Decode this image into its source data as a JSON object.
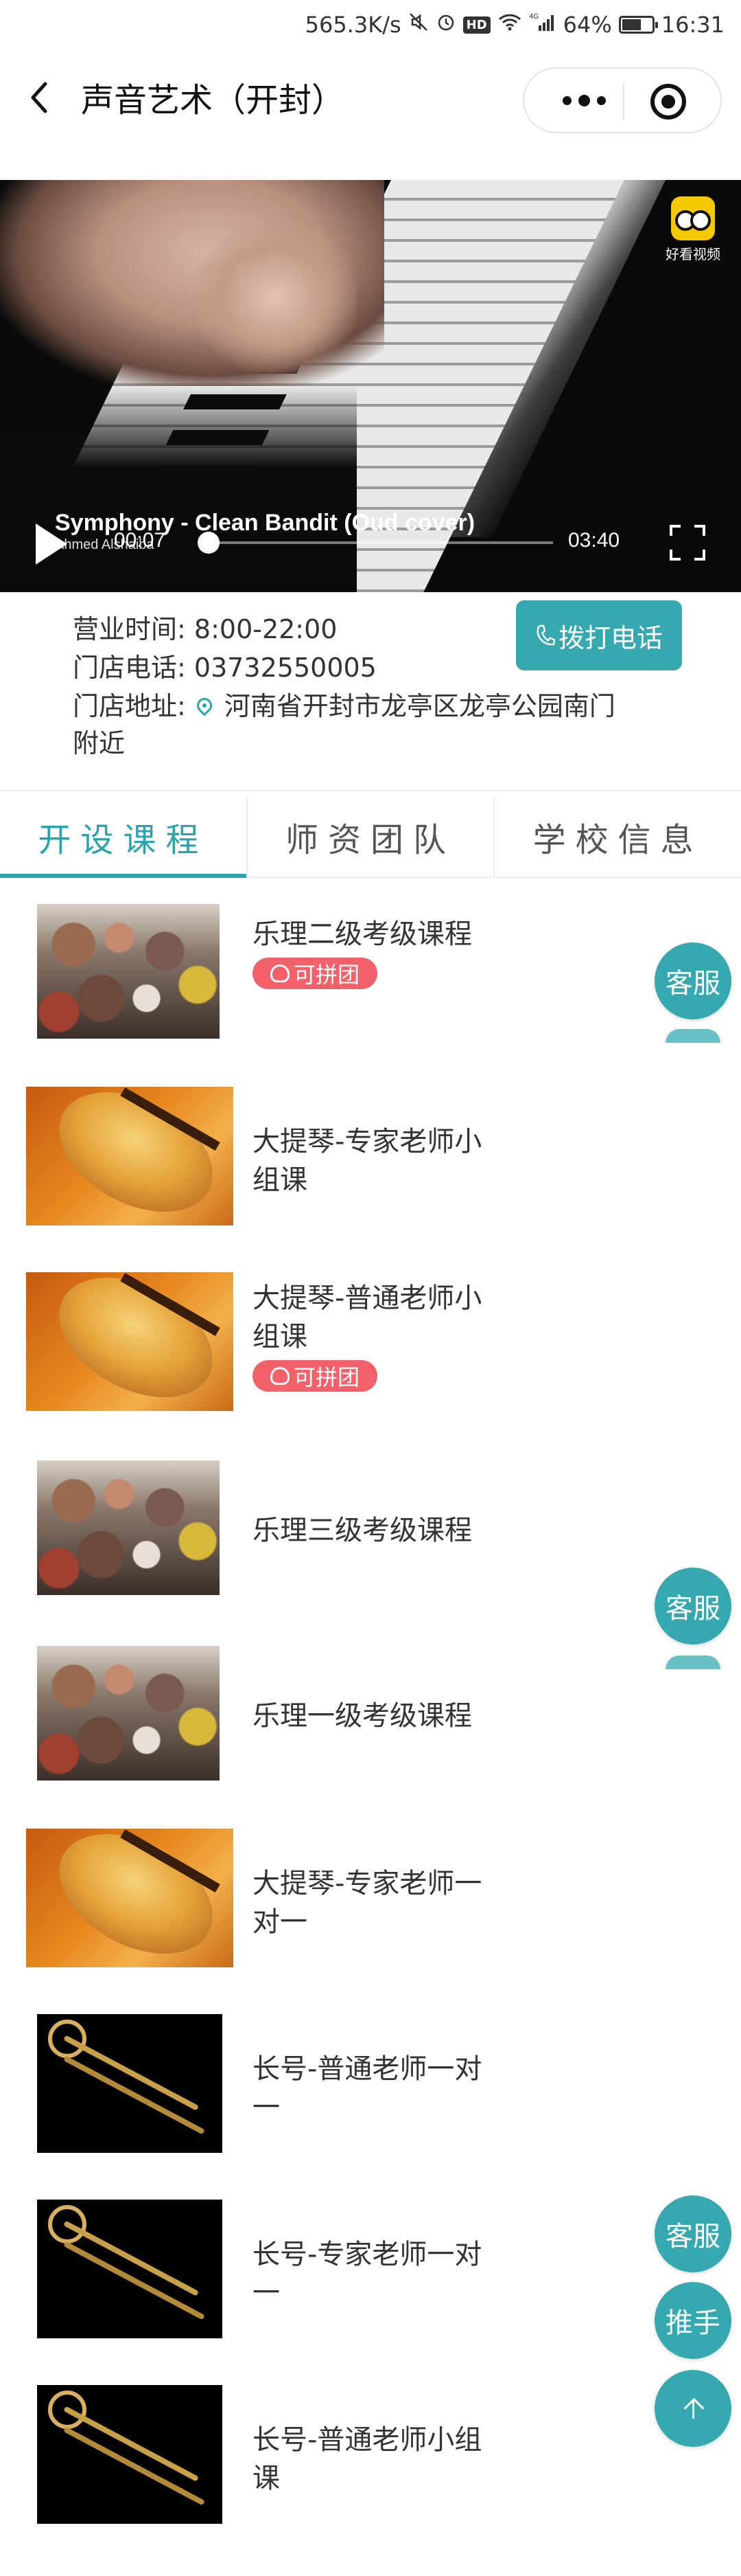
{
  "status_bar": {
    "speed": "565.3K/s",
    "signal": "4G",
    "battery_percent": "64%",
    "battery_level": 0.64,
    "time": "16:31",
    "hd_badge": "HD"
  },
  "nav": {
    "title": "声音艺术（开封）"
  },
  "video": {
    "caption": "Symphony - Clean Bandit (Oud cover)",
    "caption_sub": "Ahmed Alshaiba",
    "current_time": "00:07",
    "total_time": "03:40",
    "progress": 0.03,
    "logo_text": "好看视频",
    "slide_count": 2,
    "active_slide": 0
  },
  "store": {
    "hours_label": "营业时间:",
    "hours": "8:00-22:00",
    "phone_label": "门店电话:",
    "phone": "03732550005",
    "address_label": "门店地址:",
    "address": "河南省开封市龙亭区龙亭公园南门",
    "address_cont": "附近",
    "call_button": "拨打电话"
  },
  "tabs": [
    {
      "label": "开设课程",
      "active": true
    },
    {
      "label": "师资团队",
      "active": false
    },
    {
      "label": "学校信息",
      "active": false
    }
  ],
  "courses": [
    {
      "title": "乐理二级考级课程",
      "badge": "可拼团",
      "thumb": "orchestra"
    },
    {
      "title": "大提琴-专家老师小组课",
      "badge": "",
      "thumb": "cello"
    },
    {
      "title": "大提琴-普通老师小组课",
      "badge": "可拼团",
      "thumb": "cello"
    },
    {
      "title": "乐理三级考级课程",
      "badge": "",
      "thumb": "orchestra"
    },
    {
      "title": "乐理一级考级课程",
      "badge": "",
      "thumb": "orchestra"
    },
    {
      "title": "大提琴-专家老师一对一",
      "badge": "",
      "thumb": "cello"
    },
    {
      "title": "长号-普通老师一对一",
      "badge": "",
      "thumb": "trombone"
    },
    {
      "title": "长号-专家老师一对一",
      "badge": "",
      "thumb": "trombone"
    },
    {
      "title": "长号-普通老师小组课",
      "badge": "",
      "thumb": "trombone"
    }
  ],
  "floating": {
    "service": "客服",
    "promoter": "推手"
  },
  "colors": {
    "accent": "#36a9b0",
    "badge": "#f2616a"
  }
}
